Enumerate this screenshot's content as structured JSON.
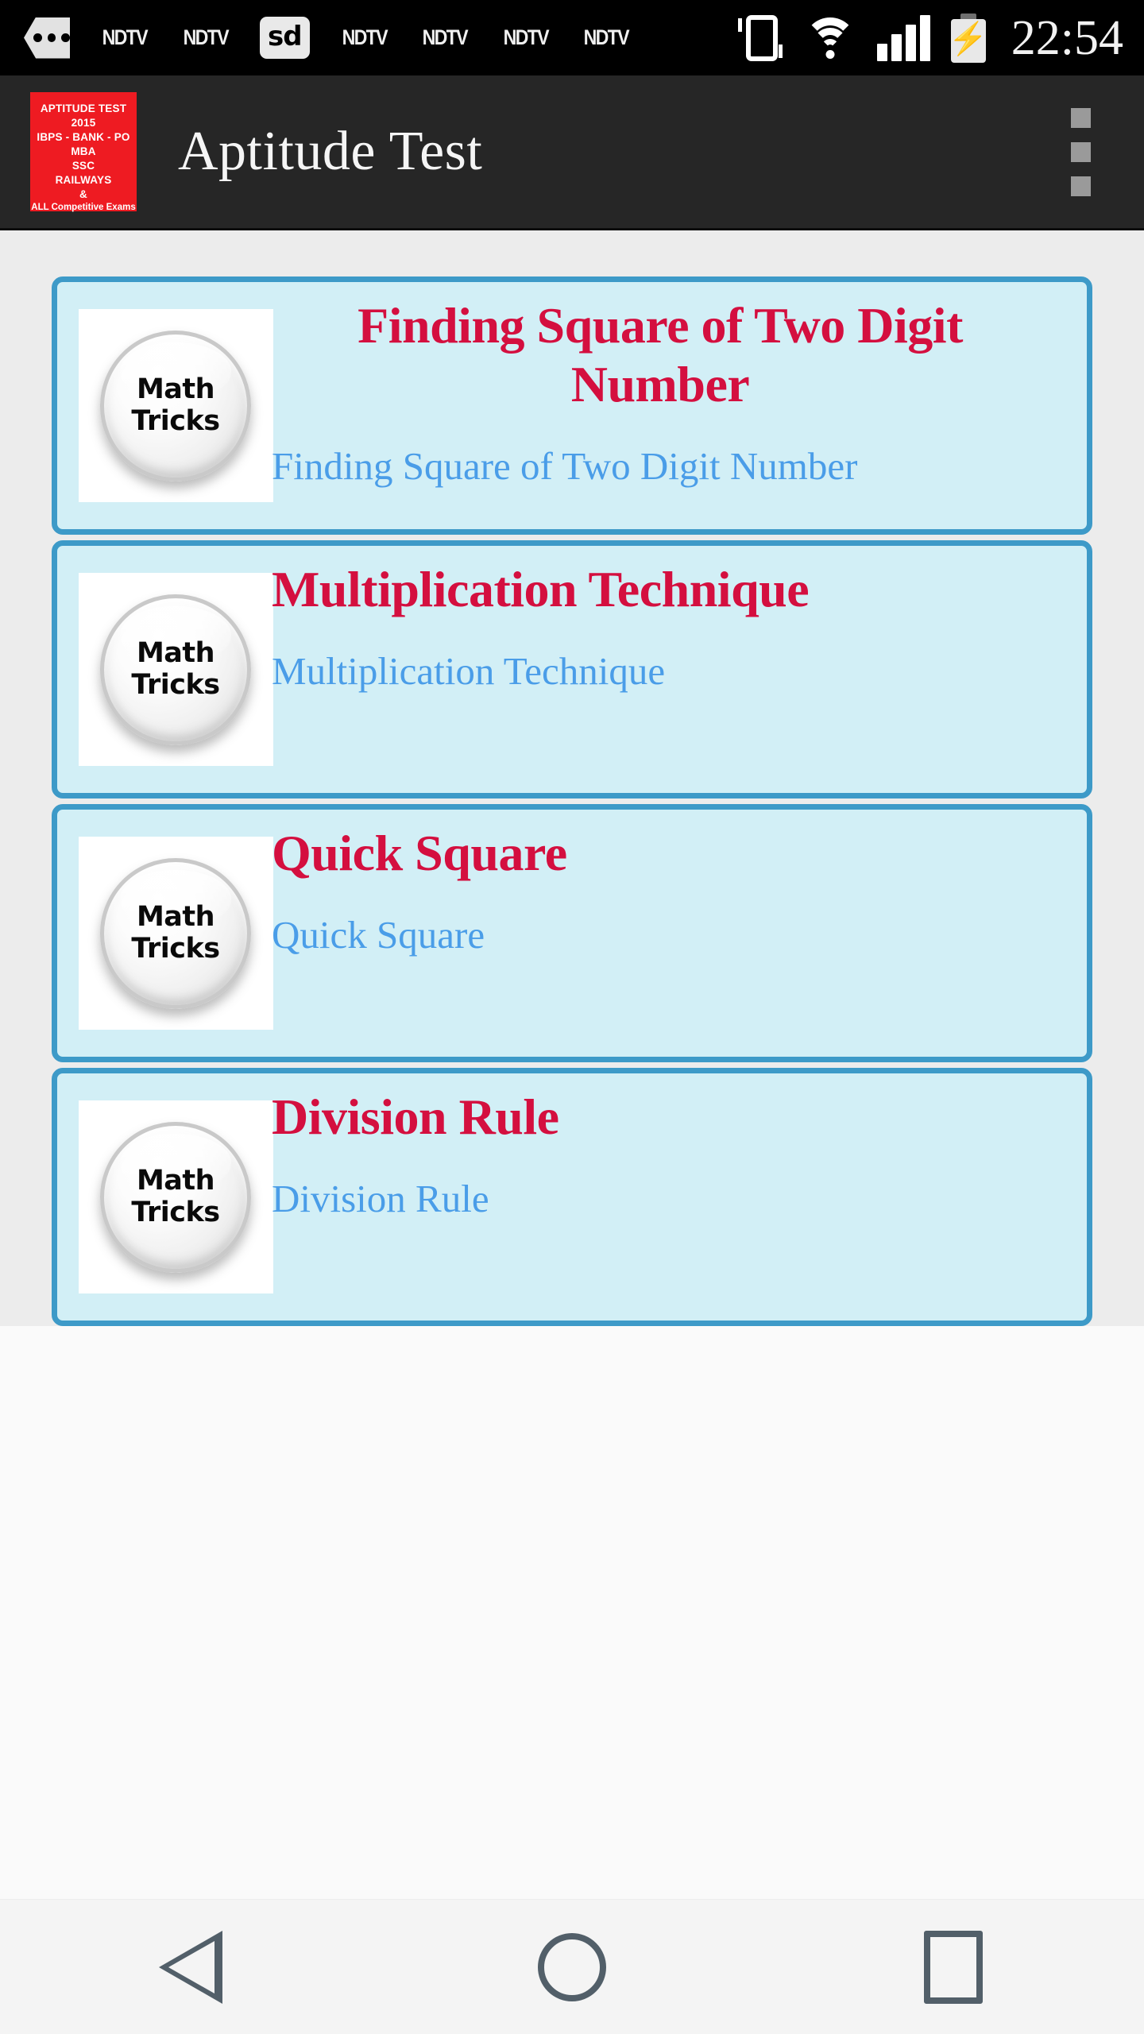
{
  "status_bar": {
    "notifications": [
      {
        "icon": "more-notifications-icon",
        "label": "•••"
      },
      {
        "icon": "ndtv-icon",
        "label": "NDTV"
      },
      {
        "icon": "ndtv-icon",
        "label": "NDTV"
      },
      {
        "icon": "sd-card-icon",
        "label": "sd"
      },
      {
        "icon": "ndtv-icon",
        "label": "NDTV"
      },
      {
        "icon": "ndtv-icon",
        "label": "NDTV"
      },
      {
        "icon": "ndtv-icon",
        "label": "NDTV"
      },
      {
        "icon": "ndtv-icon",
        "label": "NDTV"
      }
    ],
    "system_icons": [
      "vibrate-icon",
      "wifi-icon",
      "signal-bars-icon",
      "battery-charging-icon"
    ],
    "signal_bars": 4,
    "time": "22:54"
  },
  "app_bar": {
    "logo": {
      "lines": [
        "APTITUDE TEST",
        "2015",
        "IBPS - BANK - PO",
        "MBA",
        "SSC",
        "RAILWAYS",
        "&"
      ],
      "footer": "ALL Competitive Exams",
      "background": "#ee1b22"
    },
    "title": "Aptitude Test",
    "overflow_menu": "overflow-menu-icon",
    "background": "#262626"
  },
  "colors": {
    "card_background": "#d2eff6",
    "card_border": "#3d9ac8",
    "title_color": "#d40f3f",
    "subtitle_color": "#4a9de8",
    "page_background": "#ececec",
    "content_background": "#fafafa"
  },
  "list": {
    "items": [
      {
        "title": "Finding Square of Two Digit Number",
        "subtitle": "Finding Square of Two Digit Number",
        "thumbnail_line1": "Math",
        "thumbnail_line2": "Tricks"
      },
      {
        "title": "Multiplication Technique",
        "subtitle": "Multiplication Technique",
        "thumbnail_line1": "Math",
        "thumbnail_line2": "Tricks"
      },
      {
        "title": "Quick Square",
        "subtitle": "Quick Square",
        "thumbnail_line1": "Math",
        "thumbnail_line2": "Tricks"
      },
      {
        "title": "Division Rule",
        "subtitle": "Division Rule",
        "thumbnail_line1": "Math",
        "thumbnail_line2": "Tricks"
      }
    ]
  },
  "nav_bar": {
    "buttons": [
      {
        "name": "back-button",
        "icon": "triangle-left-icon"
      },
      {
        "name": "home-button",
        "icon": "circle-icon"
      },
      {
        "name": "recents-button",
        "icon": "square-icon"
      }
    ]
  }
}
